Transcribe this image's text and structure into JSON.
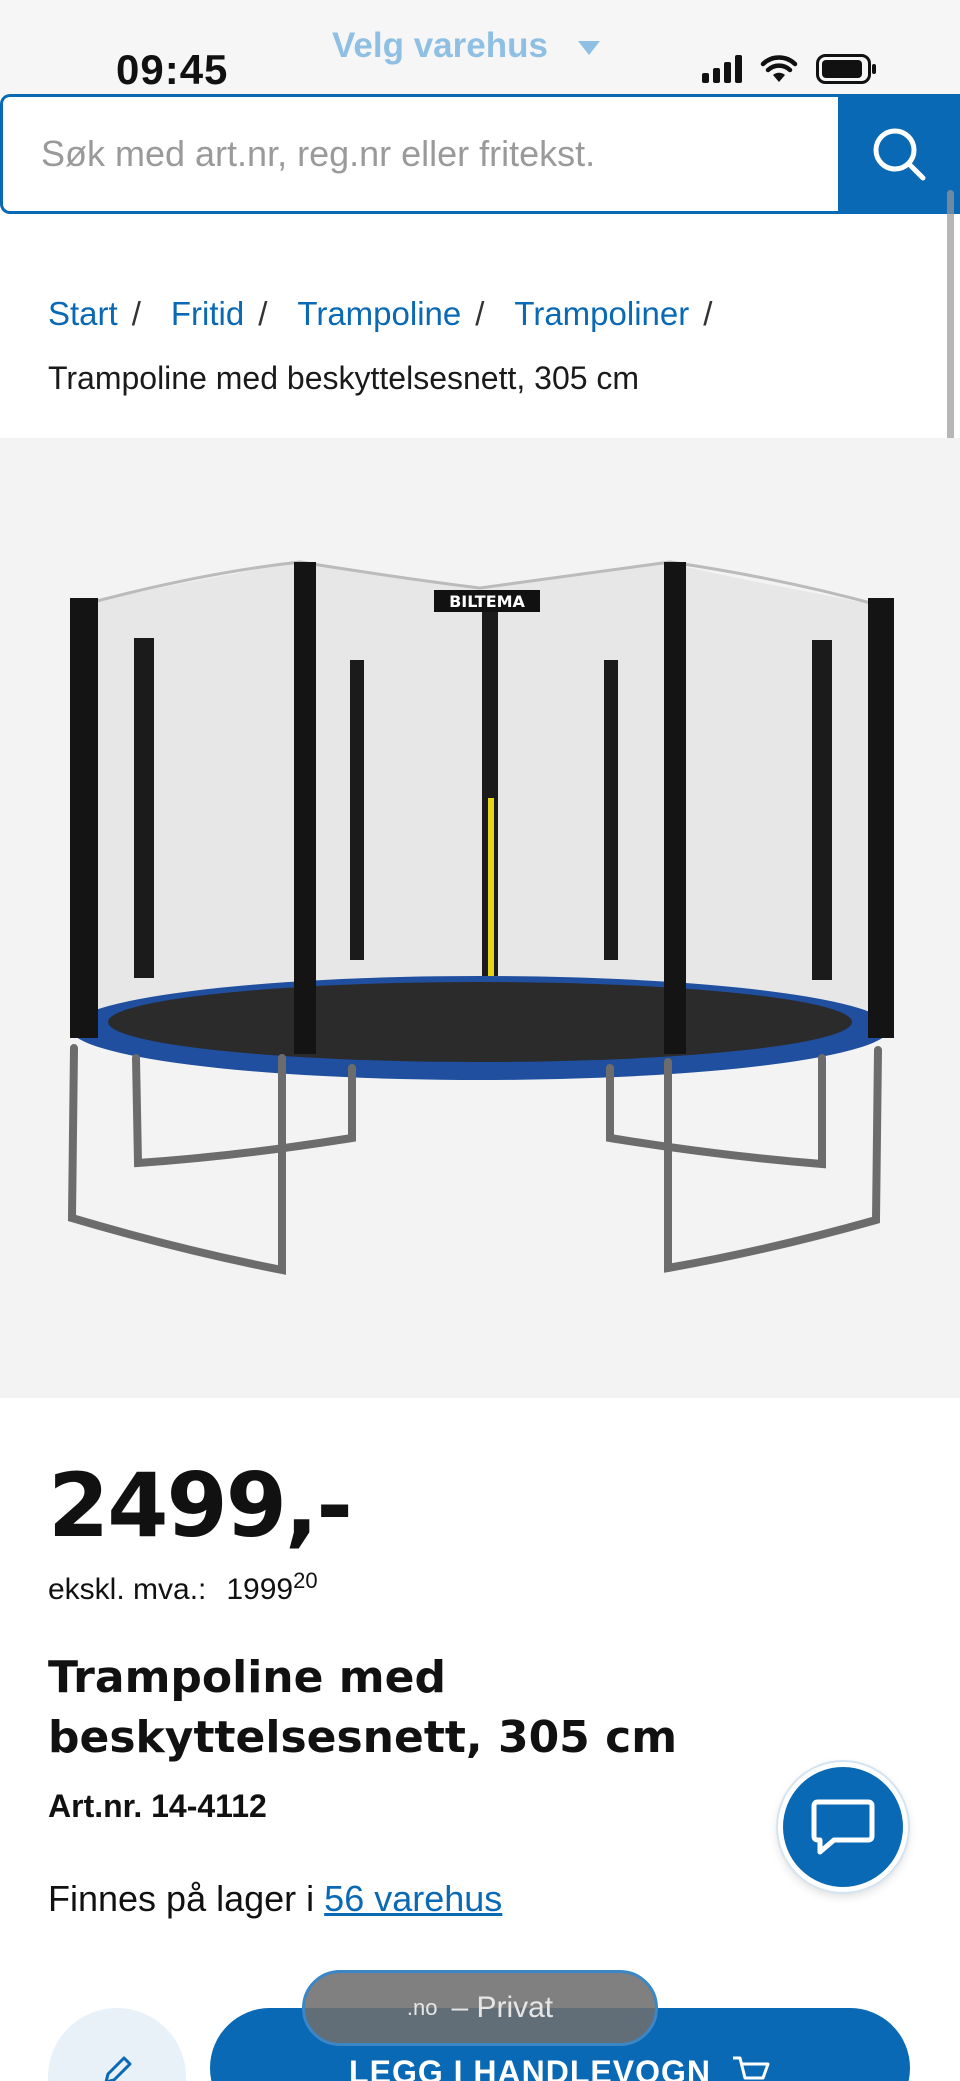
{
  "status_bar": {
    "time": "09:45"
  },
  "store_selector": {
    "label": "Velg varehus"
  },
  "search": {
    "placeholder": "Søk med art.nr, reg.nr eller fritekst."
  },
  "breadcrumb": {
    "items": [
      "Start",
      "Fritid",
      "Trampoline",
      "Trampoliner"
    ],
    "separator": "/",
    "current": "Trampoline med beskyttelsesnett, 305 cm"
  },
  "product": {
    "image_brand_text": "BILTEMA",
    "price": "2499,-",
    "ex_vat_label": "ekskl. mva.:",
    "ex_vat_value": "1999",
    "ex_vat_decimals": "20",
    "title": "Trampoline med beskyttelsesnett, 305 cm",
    "art_nr": "Art.nr. 14-4112",
    "stock_prefix": "Finnes på lager i",
    "stock_link": "56 varehus"
  },
  "actions": {
    "add_to_cart": "LEGG I HANDLEVOGN",
    "site_domain": ".no",
    "site_mode": "– Privat"
  },
  "colors": {
    "brand_blue": "#0a69b4",
    "light_blue": "#8fc0e3"
  },
  "icons": {
    "search": "search-icon",
    "chat": "chat-icon",
    "edit": "pencil-icon",
    "cart": "cart-icon"
  }
}
